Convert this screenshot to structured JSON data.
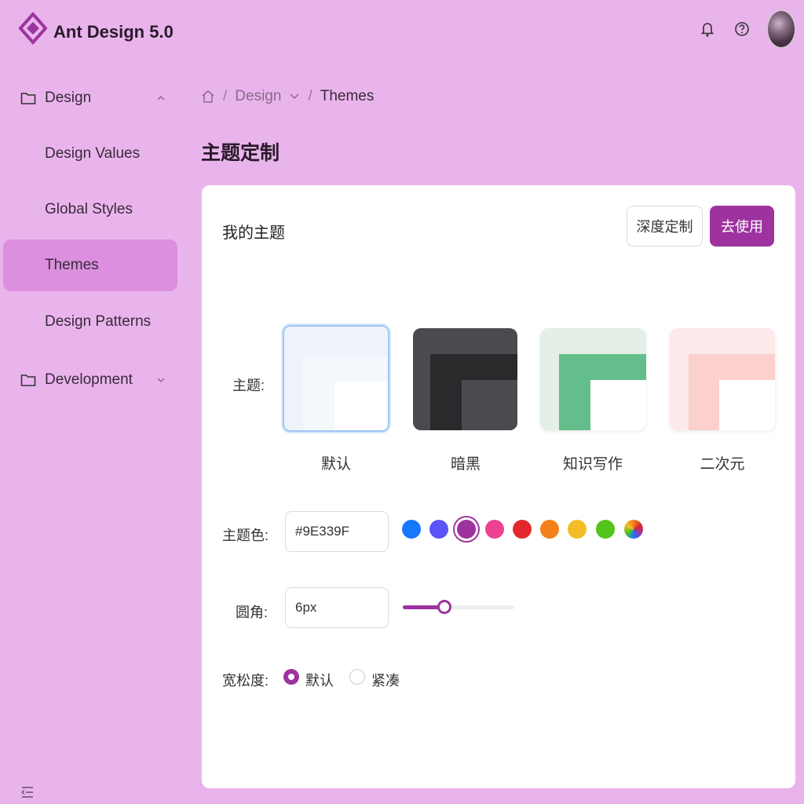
{
  "app": {
    "title": "Ant Design 5.0"
  },
  "header": {
    "icons": [
      "bell-icon",
      "help-icon"
    ],
    "avatar": "avatar"
  },
  "sidebar": {
    "items": [
      {
        "label": "Design",
        "type": "group",
        "expanded": true
      },
      {
        "label": "Design Values",
        "type": "sub"
      },
      {
        "label": "Global Styles",
        "type": "sub"
      },
      {
        "label": "Themes",
        "type": "sub",
        "active": true
      },
      {
        "label": "Design Patterns",
        "type": "sub"
      },
      {
        "label": "Development",
        "type": "group",
        "expanded": false
      }
    ]
  },
  "breadcrumb": {
    "items": [
      "Design",
      "Themes"
    ],
    "separator": "/"
  },
  "page": {
    "title": "主题定制"
  },
  "card": {
    "title": "我的主题",
    "buttons": {
      "customize": "深度定制",
      "apply": "去使用"
    },
    "theme": {
      "label": "主题:",
      "options": [
        {
          "name": "默认",
          "selected": true
        },
        {
          "name": "暗黑"
        },
        {
          "name": "知识写作"
        },
        {
          "name": "二次元"
        }
      ]
    },
    "color": {
      "label": "主题色:",
      "value": "#9E339F",
      "swatches": [
        "#1677ff",
        "#5a54f9",
        "#9e339f",
        "#ed4192",
        "#e0282e",
        "#f4801a",
        "#f2bd27",
        "#52c41a",
        "gradient"
      ],
      "selected": "#9e339f"
    },
    "radius": {
      "label": "圆角:",
      "value": "6px",
      "slider_level": 0.37
    },
    "density": {
      "label": "宽松度:",
      "options": [
        {
          "label": "默认",
          "checked": true
        },
        {
          "label": "紧凑",
          "checked": false
        }
      ]
    }
  },
  "colors": {
    "primary": "#9e339f",
    "background": "#e9b4ec",
    "active_menu": "#dc8fde"
  }
}
